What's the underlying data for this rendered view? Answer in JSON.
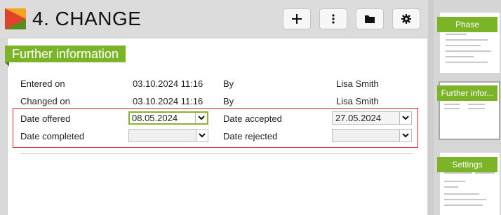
{
  "header": {
    "title": "4. CHANGE",
    "buttons": [
      {
        "name": "add-button",
        "icon": "plus-icon"
      },
      {
        "name": "more-button",
        "icon": "vertical-dots-icon"
      },
      {
        "name": "folder-button",
        "icon": "folder-icon"
      },
      {
        "name": "settings-button",
        "icon": "gear-icon"
      }
    ]
  },
  "section": {
    "title": "Further information",
    "rows": {
      "entered_label": "Entered on",
      "entered_value": "03.10.2024 11:16",
      "entered_by_label": "By",
      "entered_by_value": "Lisa Smith",
      "changed_label": "Changed on",
      "changed_value": "03.10.2024 11:16",
      "changed_by_label": "By",
      "changed_by_value": "Lisa Smith",
      "offered_label": "Date offered",
      "offered_value": "08.05.2024",
      "accepted_label": "Date accepted",
      "accepted_value": "27.05.2024",
      "completed_label": "Date completed",
      "completed_value": "",
      "rejected_label": "Date rejected",
      "rejected_value": ""
    }
  },
  "thumbnails": [
    {
      "label": "Phase"
    },
    {
      "label": "Further infor..."
    },
    {
      "label": "Settings"
    }
  ],
  "colors": {
    "accent": "#7cb428",
    "highlight_border": "#d9252a"
  }
}
